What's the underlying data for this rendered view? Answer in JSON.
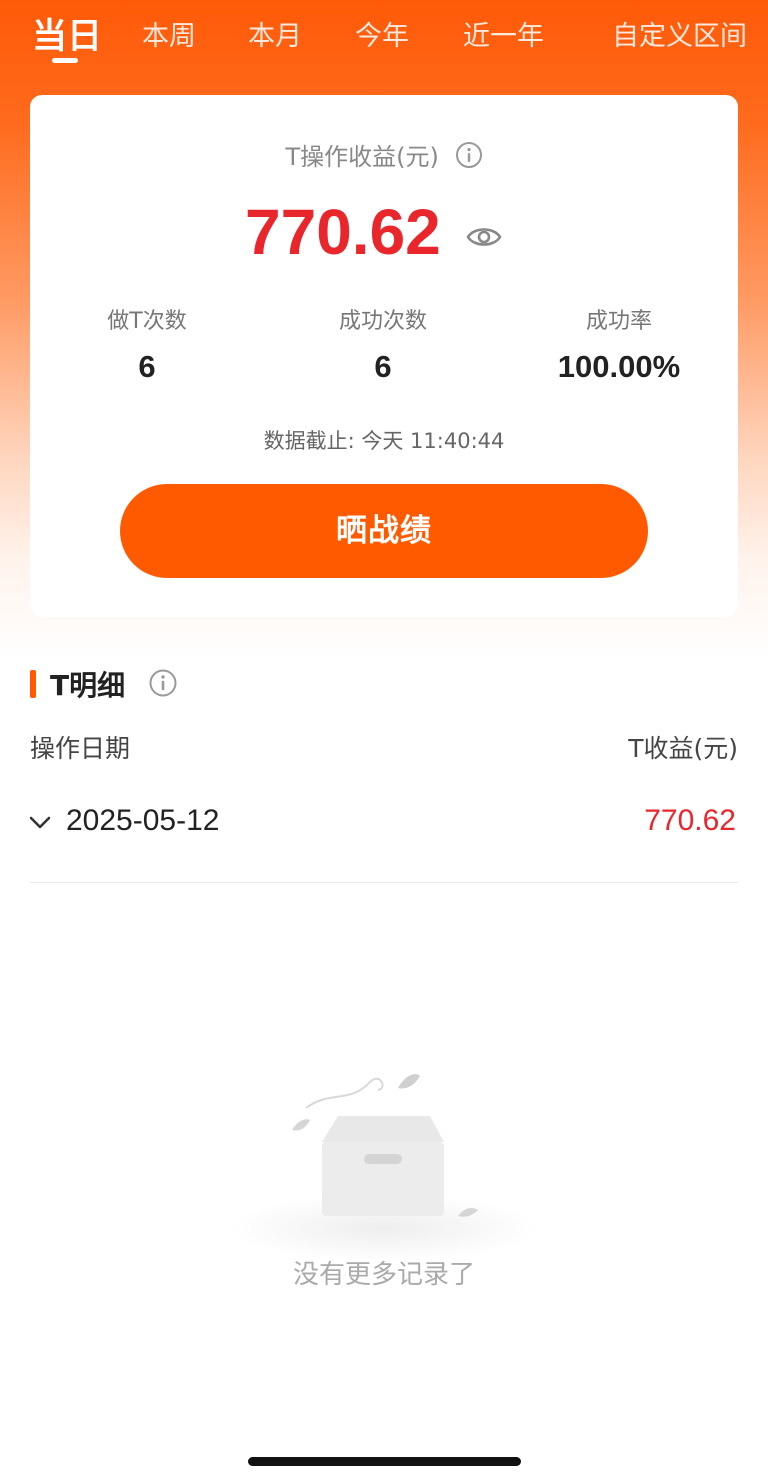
{
  "tabs": [
    {
      "label": "当日",
      "active": true
    },
    {
      "label": "本周",
      "active": false
    },
    {
      "label": "本月",
      "active": false
    },
    {
      "label": "今年",
      "active": false
    },
    {
      "label": "近一年",
      "active": false
    },
    {
      "label": "自定义区间",
      "active": false
    }
  ],
  "summary": {
    "title": "T操作收益(元)",
    "value": "770.62",
    "stats": [
      {
        "label": "做T次数",
        "value": "6"
      },
      {
        "label": "成功次数",
        "value": "6"
      },
      {
        "label": "成功率",
        "value": "100.00%"
      }
    ],
    "as_of": "数据截止: 今天 11:40:44",
    "share_label": "晒战绩"
  },
  "detail": {
    "title": "T明细",
    "columns": {
      "date": "操作日期",
      "profit": "T收益(元)"
    },
    "rows": [
      {
        "date": "2025-05-12",
        "profit": "770.62"
      }
    ],
    "empty_text": "没有更多记录了"
  },
  "colors": {
    "accent": "#ff5a00",
    "profit_red": "#e8262c"
  },
  "icons": {
    "info": "info-icon",
    "eye": "eye-icon",
    "chevron": "chevron-down-icon",
    "empty": "empty-box-icon"
  }
}
